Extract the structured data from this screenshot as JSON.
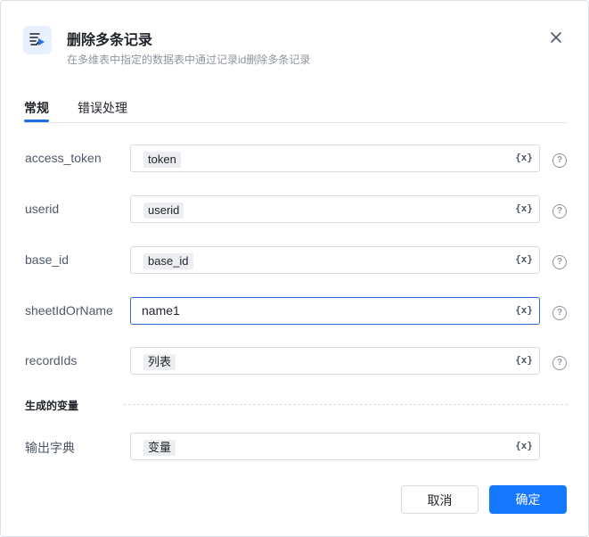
{
  "dialog": {
    "title": "删除多条记录",
    "subtitle": "在多维表中指定的数据表中通过记录id删除多条记录"
  },
  "tabs": [
    {
      "label": "常规",
      "active": true
    },
    {
      "label": "错误处理",
      "active": false
    }
  ],
  "fields": [
    {
      "label": "access_token",
      "value": "token",
      "type": "chip"
    },
    {
      "label": "userid",
      "value": "userid",
      "type": "chip"
    },
    {
      "label": "base_id",
      "value": "base_id",
      "type": "chip"
    },
    {
      "label": "sheetIdOrName",
      "value": "name1",
      "type": "text"
    },
    {
      "label": "recordIds",
      "value": "列表",
      "type": "chip"
    }
  ],
  "var_button_label": "{x}",
  "help_glyph": "?",
  "section": {
    "title": "生成的变量",
    "output_label": "输出字典",
    "output_value": "变量"
  },
  "buttons": {
    "cancel": "取消",
    "ok": "确定"
  },
  "colors": {
    "accent": "#1677ff",
    "focus_border": "#2d6ad6",
    "icon_bg": "#e8f0fd"
  }
}
